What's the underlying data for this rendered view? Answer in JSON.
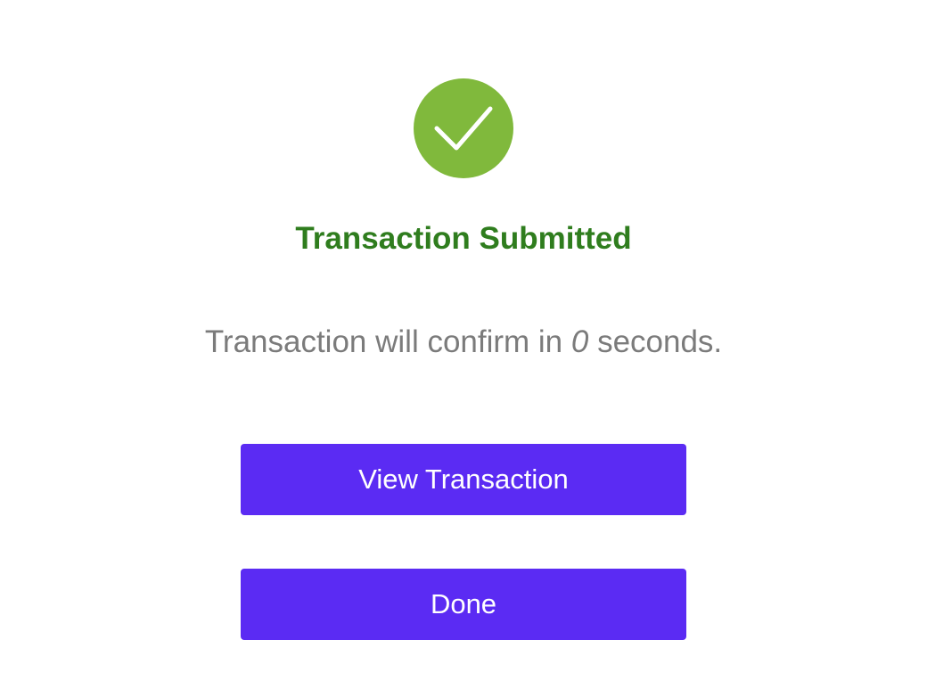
{
  "status": {
    "icon": "check-circle-icon",
    "color": "#80b93c",
    "title": "Transaction Submitted",
    "title_color": "#2f7d1e"
  },
  "message": {
    "prefix": "Transaction will confirm in ",
    "count": "0",
    "suffix": " seconds."
  },
  "buttons": {
    "view_label": "View Transaction",
    "done_label": "Done",
    "color": "#5b2bf3"
  }
}
